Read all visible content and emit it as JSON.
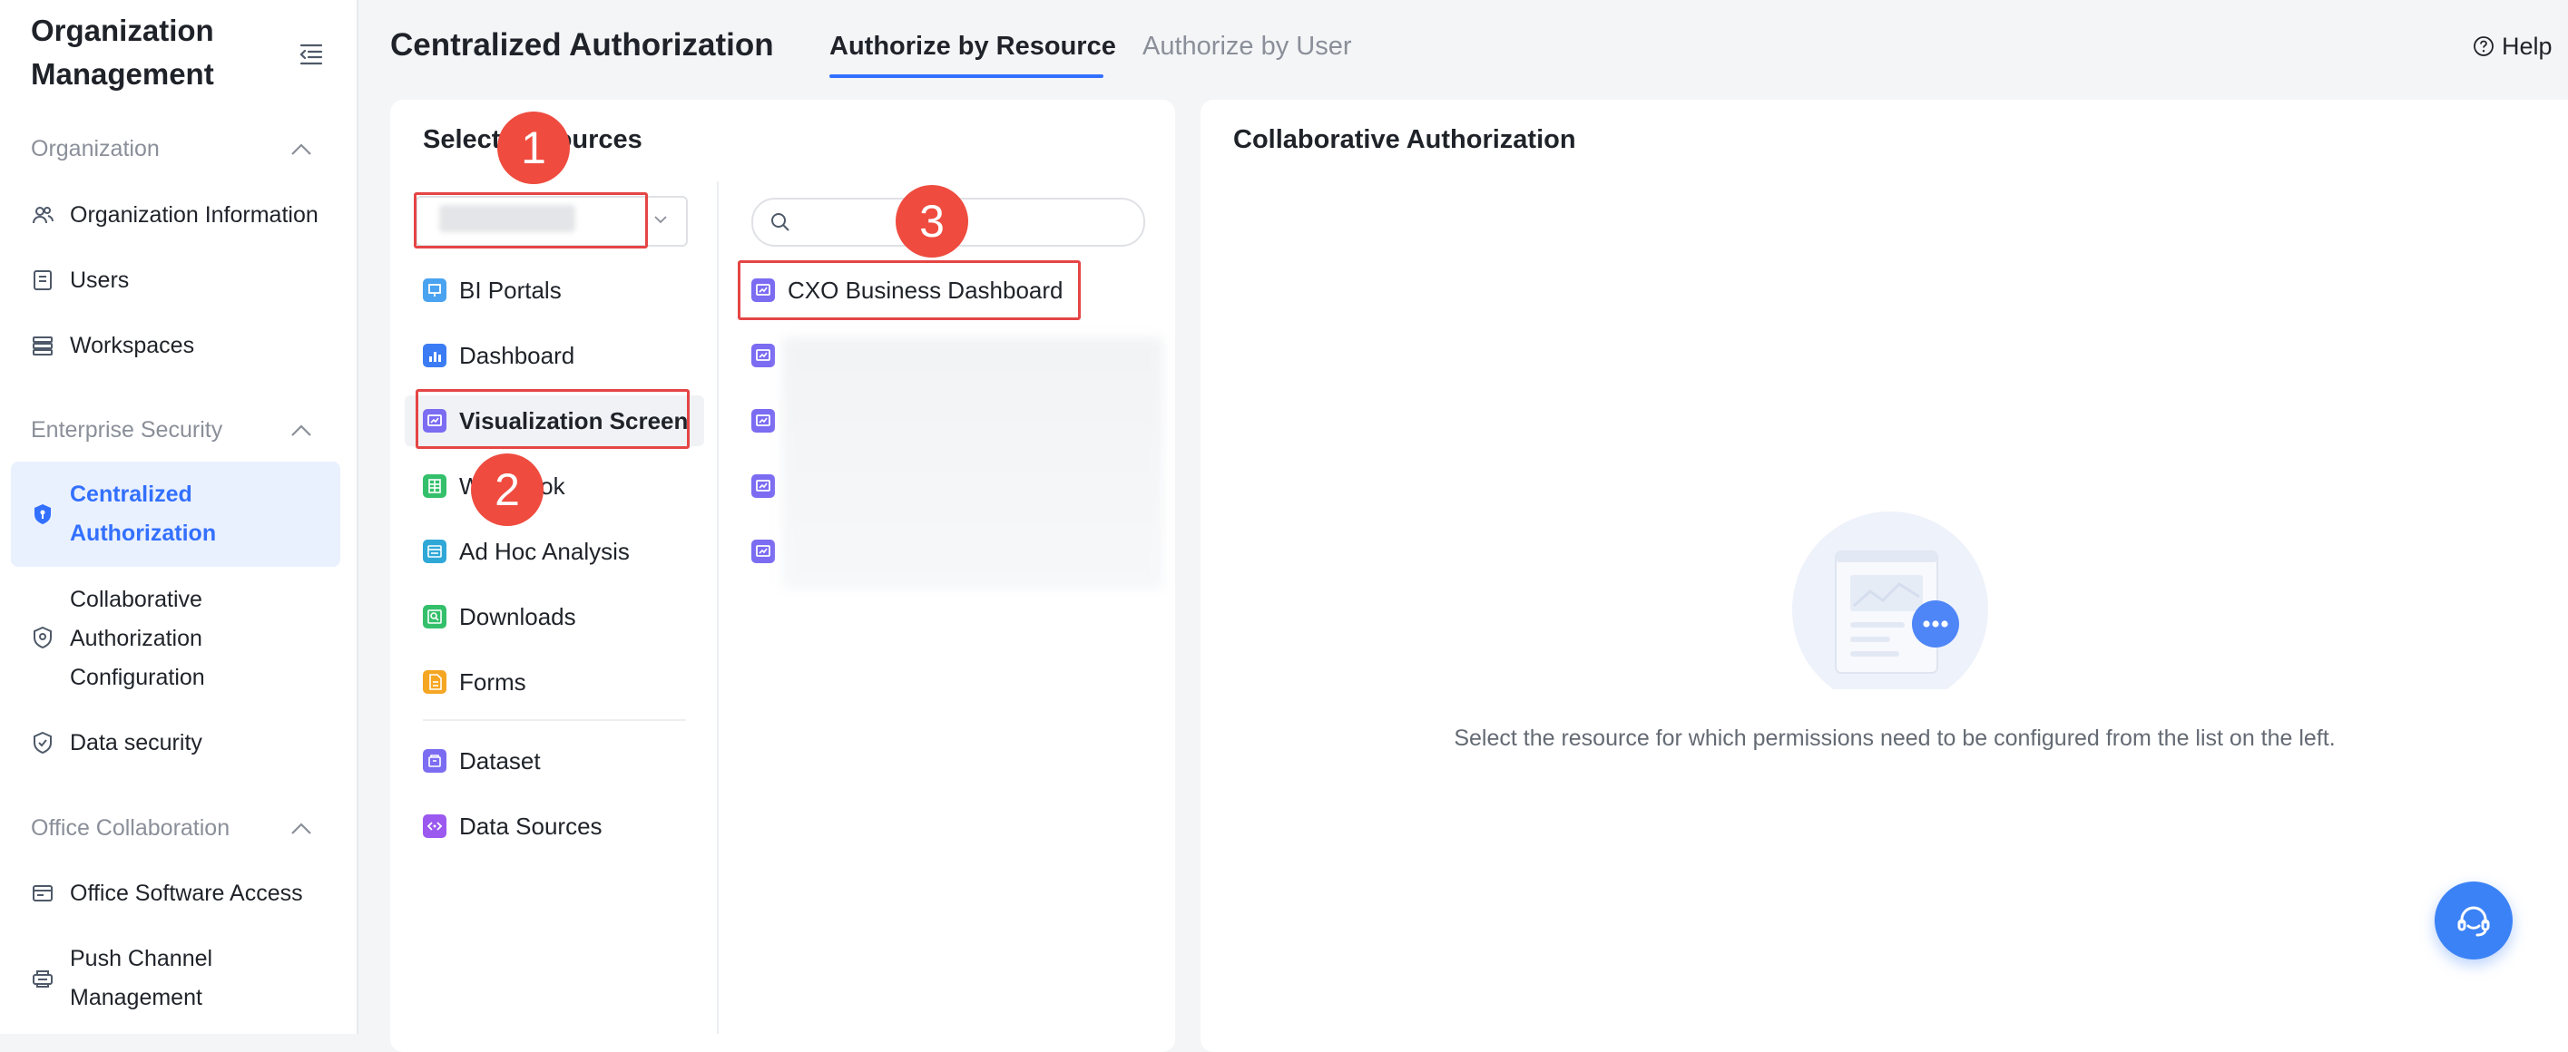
{
  "sidebar": {
    "title": "Organization Management",
    "sections": [
      {
        "label": "Organization",
        "items": [
          "Organization Information",
          "Users",
          "Workspaces"
        ]
      },
      {
        "label": "Enterprise Security",
        "items": [
          "Centralized Authorization",
          "Collaborative Authorization Configuration",
          "Data security"
        ]
      },
      {
        "label": "Office Collaboration",
        "items": [
          "Office Software Access",
          "Push Channel Management"
        ]
      }
    ],
    "active_item": "Centralized Authorization"
  },
  "header": {
    "title": "Centralized Authorization",
    "tabs": [
      {
        "label": "Authorize by Resource",
        "active": true
      },
      {
        "label": "Authorize by User",
        "active": false
      }
    ],
    "help_label": "Help"
  },
  "resources_panel": {
    "title": "Select Resources",
    "resource_types": [
      {
        "label": "BI Portals",
        "icon": "portal-icon",
        "color": "#4aa3f0"
      },
      {
        "label": "Dashboard",
        "icon": "bar-chart-icon",
        "color": "#3b7cf5"
      },
      {
        "label": "Visualization Screen",
        "icon": "screen-icon",
        "color": "#7b6cf2",
        "selected": true
      },
      {
        "label": "Workbook",
        "icon": "spreadsheet-icon",
        "color": "#34c06b"
      },
      {
        "label": "Ad Hoc Analysis",
        "icon": "analysis-icon",
        "color": "#2fa8d8"
      },
      {
        "label": "Downloads",
        "icon": "download-icon",
        "color": "#34c06b"
      },
      {
        "label": "Forms",
        "icon": "form-icon",
        "color": "#f5a623"
      },
      {
        "label": "Dataset",
        "icon": "dataset-icon",
        "color": "#7b6cf2"
      },
      {
        "label": "Data Sources",
        "icon": "datasource-icon",
        "color": "#9b59f0"
      }
    ],
    "resources": [
      {
        "label": "CXO Business Dashboard"
      }
    ]
  },
  "collab_panel": {
    "title": "Collaborative Authorization",
    "empty_text": "Select the resource for which permissions need to be configured from the list on the left."
  },
  "annotations": [
    "1",
    "2",
    "3"
  ],
  "colors": {
    "accent": "#3370ff",
    "highlight": "#e54545",
    "badge": "#ef4b3f"
  }
}
